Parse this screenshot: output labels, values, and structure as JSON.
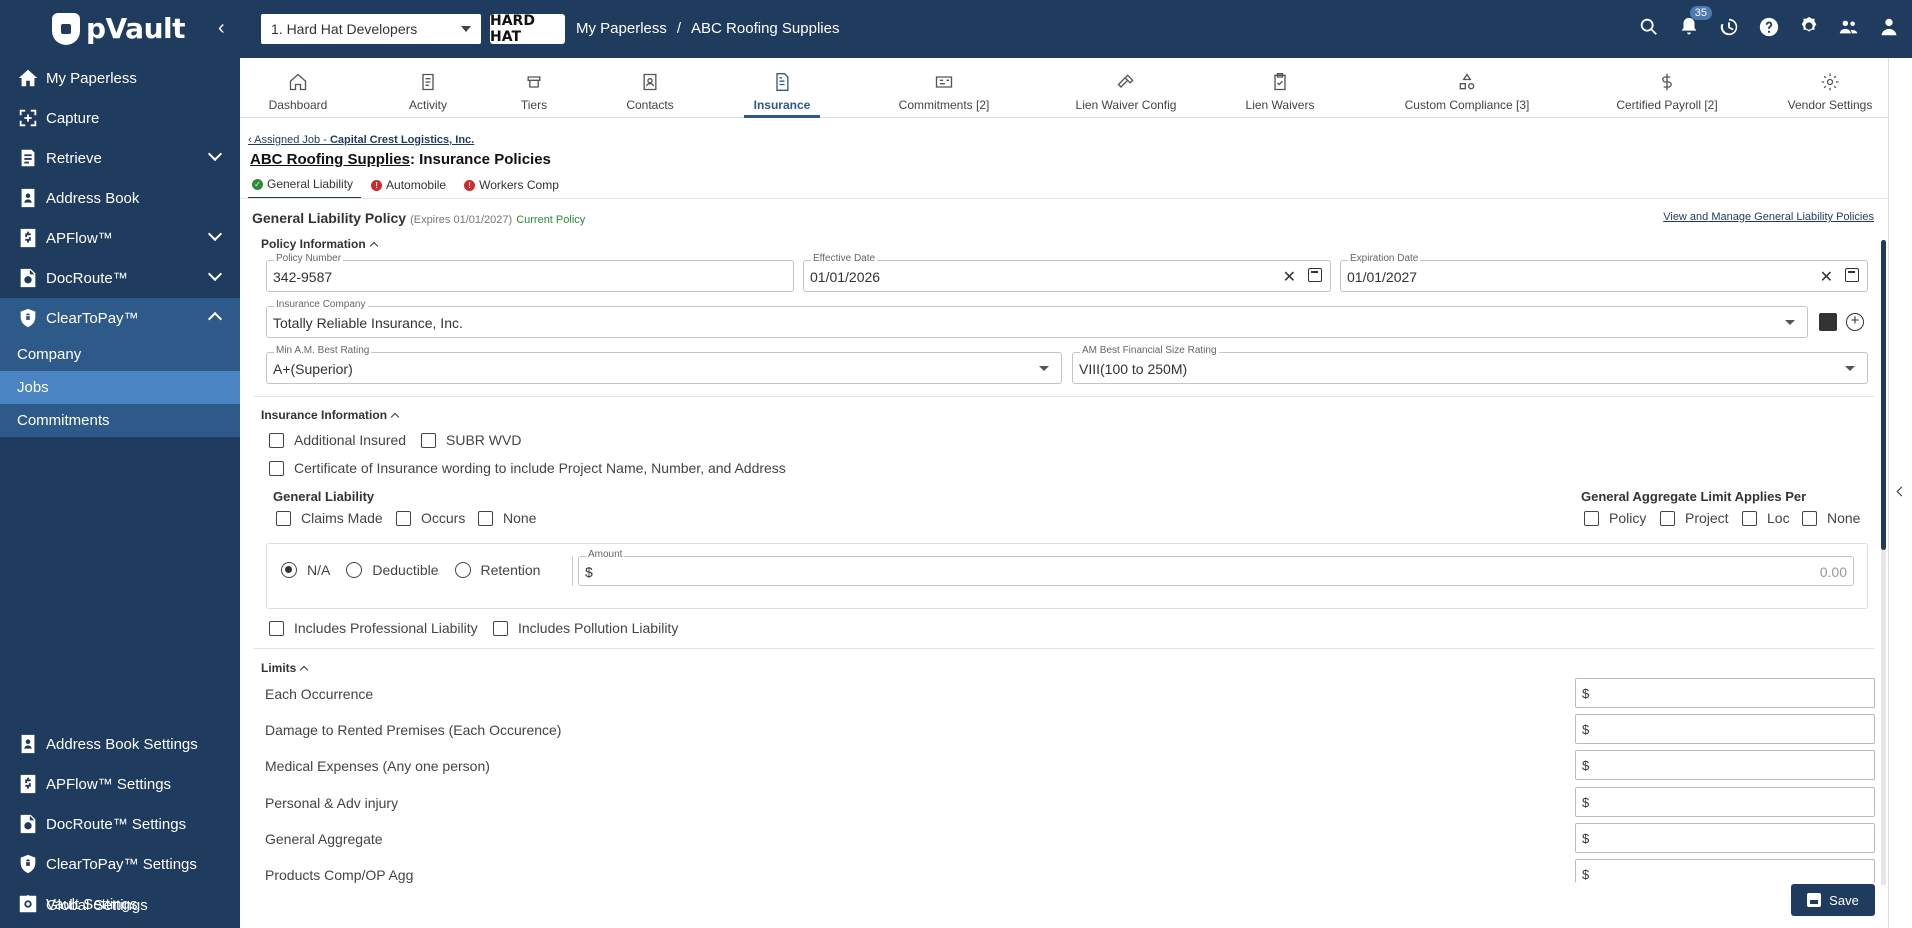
{
  "app": {
    "logo": "pVault"
  },
  "topbar": {
    "job_select": "1. Hard Hat Developers",
    "company_logo": "HARD HAT",
    "breadcrumb": [
      "My Paperless",
      "ABC Roofing Supplies"
    ],
    "notif_count": "35"
  },
  "sidebar": {
    "items": [
      {
        "label": "My Paperless",
        "icon": "home-icon"
      },
      {
        "label": "Capture",
        "icon": "capture-icon"
      },
      {
        "label": "Retrieve",
        "icon": "retrieve-icon"
      },
      {
        "label": "Address Book",
        "icon": "address-book-icon"
      },
      {
        "label": "APFlow™",
        "icon": "apflow-icon"
      },
      {
        "label": "DocRoute™",
        "icon": "docroute-icon"
      },
      {
        "label": "ClearToPay™",
        "icon": "cleartopay-icon"
      }
    ],
    "sub_items": [
      "Company",
      "Jobs",
      "Commitments"
    ],
    "settings": [
      {
        "label": "Address Book Settings"
      },
      {
        "label": "APFlow™ Settings"
      },
      {
        "label": "DocRoute™ Settings"
      },
      {
        "label": "ClearToPay™ Settings"
      },
      {
        "label": "Vault Settings"
      },
      {
        "label": "Global Settings"
      }
    ]
  },
  "tabs": [
    {
      "label": "Dashboard"
    },
    {
      "label": "Activity"
    },
    {
      "label": "Tiers"
    },
    {
      "label": "Contacts"
    },
    {
      "label": "Insurance"
    },
    {
      "label": "Commitments [2]"
    },
    {
      "label": "Lien Waiver Config"
    },
    {
      "label": "Lien Waivers"
    },
    {
      "label": "Custom Compliance [3]"
    },
    {
      "label": "Certified Payroll [2]"
    },
    {
      "label": "Vendor Settings"
    }
  ],
  "page": {
    "back_prefix": "Assigned Job - ",
    "back_job": "Capital Crest Logistics, Inc.",
    "vendor": "ABC Roofing Supplies",
    "title_suffix": ": Insurance Policies",
    "subtabs": [
      "General Liability",
      "Automobile",
      "Workers Comp"
    ]
  },
  "policy": {
    "title": "General Liability Policy",
    "expires": "(Expires 01/01/2027)",
    "status": "Current Policy",
    "manage_link": "View and Manage General Liability Policies"
  },
  "policy_info": {
    "heading": "Policy Information",
    "policy_number_label": "Policy Number",
    "policy_number": "342-9587",
    "effective_label": "Effective Date",
    "effective": "01/01/2026",
    "expiration_label": "Expiration Date",
    "expiration": "01/01/2027",
    "insurer_label": "Insurance Company",
    "insurer": "Totally Reliable Insurance, Inc.",
    "rating_label": "Min A.M. Best Rating",
    "rating": "A+(Superior)",
    "size_label": "AM Best Financial Size Rating",
    "size": "VIII(100 to 250M)"
  },
  "insurance_info": {
    "heading": "Insurance Information",
    "additional_insured": "Additional Insured",
    "subr_wvd": "SUBR WVD",
    "certificate": "Certificate of Insurance wording to include Project Name, Number, and Address",
    "gl_heading": "General Liability",
    "gl_options": [
      "Claims Made",
      "Occurs",
      "None"
    ],
    "agg_heading": "General Aggregate Limit Applies Per",
    "agg_options": [
      "Policy",
      "Project",
      "Loc",
      "None"
    ],
    "radios": [
      "N/A",
      "Deductible",
      "Retention"
    ],
    "amount_label": "Amount",
    "amount_currency": "$",
    "amount_value": "0.00",
    "prof_liability": "Includes Professional Liability",
    "poll_liability": "Includes Pollution Liability"
  },
  "limits": {
    "heading": "Limits",
    "currency": "$",
    "rows": [
      "Each Occurrence",
      "Damage to Rented Premises (Each Occurence)",
      "Medical Expenses (Any one person)",
      "Personal & Adv injury",
      "General Aggregate",
      "Products Comp/OP Agg"
    ]
  },
  "save_label": "Save"
}
